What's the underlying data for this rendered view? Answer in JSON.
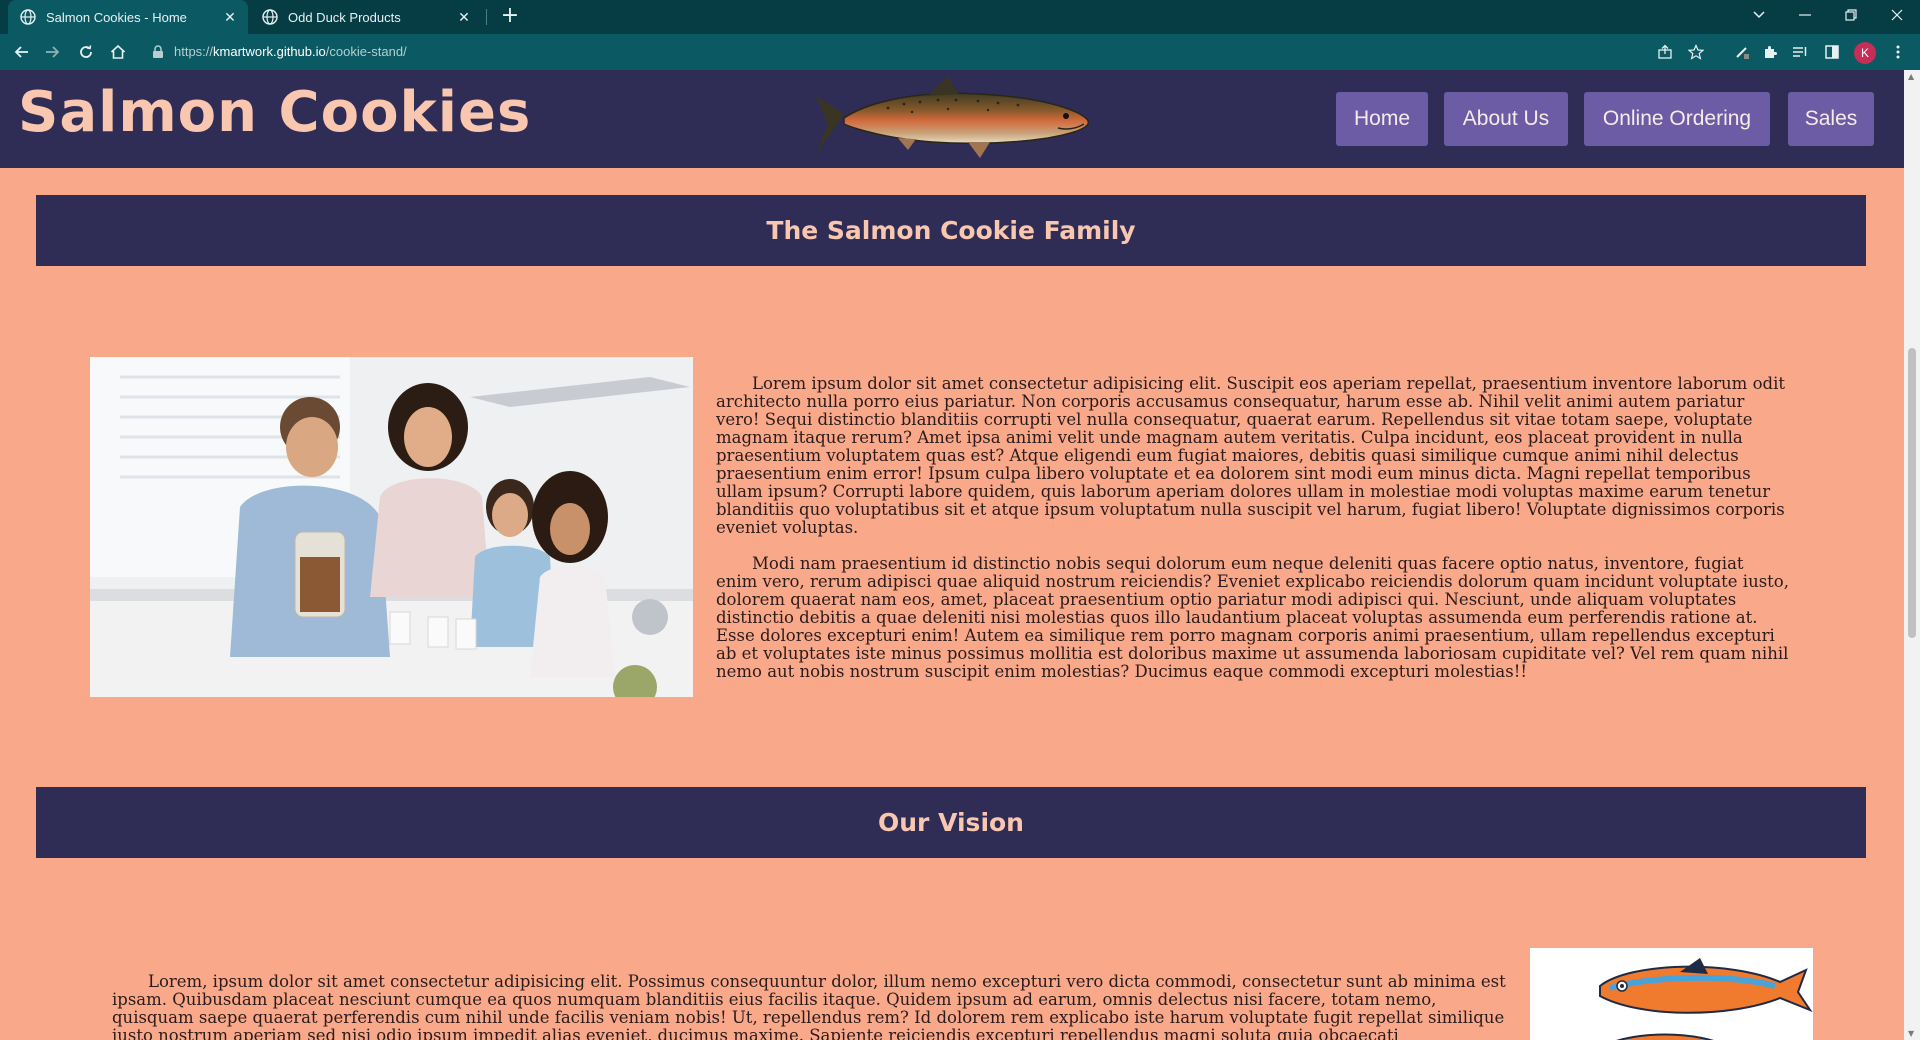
{
  "browser": {
    "tabs": [
      {
        "title": "Salmon Cookies - Home",
        "active": true
      },
      {
        "title": "Odd Duck Products",
        "active": false
      }
    ],
    "url_scheme": "https://",
    "url_host": "kmartwork.github.io",
    "url_path": "/cookie-stand/",
    "profile_initial": "K",
    "colors": {
      "frame": "#063d45",
      "toolbar": "#0b5963",
      "avatar": "#c62d57"
    }
  },
  "site": {
    "title": "Salmon Cookies",
    "nav": [
      "Home",
      "About Us",
      "Online Ordering",
      "Sales"
    ],
    "colors": {
      "header": "#2f2d56",
      "accent": "#f9c7b0",
      "nav_button": "#6b5ca5",
      "background": "#f9a98a"
    }
  },
  "sections": [
    {
      "heading": "The Salmon Cookie Family",
      "paragraphs": [
        "Lorem ipsum dolor sit amet consectetur adipisicing elit. Suscipit eos aperiam repellat, praesentium inventore laborum odit architecto nulla porro eius pariatur. Non corporis accusamus consequatur, harum esse ab. Nihil velit animi autem pariatur vero! Sequi distinctio blanditiis corrupti vel nulla consequatur, quaerat earum. Repellendus sit vitae totam saepe, voluptate magnam itaque rerum? Amet ipsa animi velit unde magnam autem veritatis. Culpa incidunt, eos placeat provident in nulla praesentium voluptatem quas est? Atque eligendi eum fugiat maiores, debitis quasi similique cumque animi nihil delectus praesentium enim error! Ipsum culpa libero voluptate et ea dolorem sint modi eum minus dicta. Magni repellat temporibus ullam ipsum? Corrupti labore quidem, quis laborum aperiam dolores ullam in molestiae modi voluptas maxime earum tenetur blanditiis quo voluptatibus sit et atque ipsum voluptatum nulla suscipit vel harum, fugiat libero! Voluptate dignissimos corporis eveniet voluptas.",
        "Modi nam praesentium id distinctio nobis sequi dolorum eum neque deleniti quas facere optio natus, inventore, fugiat enim vero, rerum adipisci quae aliquid nostrum reiciendis? Eveniet explicabo reiciendis dolorum quam incidunt voluptate iusto, dolorem quaerat nam eos, amet, placeat praesentium optio pariatur modi adipisci qui. Nesciunt, unde aliquam voluptates distinctio debitis a quae deleniti nisi molestias quos illo laudantium placeat voluptas assumenda eum perferendis ratione at. Esse dolores excepturi enim! Autem ea similique rem porro magnam corporis animi praesentium, ullam repellendus excepturi ab et voluptates iste minus possimus mollitia est doloribus maxime ut assumenda laboriosam cupiditate vel? Vel rem quam nihil nemo aut nobis nostrum suscipit enim molestias? Ducimus eaque commodi excepturi molestias!!"
      ]
    },
    {
      "heading": "Our Vision",
      "paragraphs": [
        "Lorem, ipsum dolor sit amet consectetur adipisicing elit. Possimus consequuntur dolor, illum nemo excepturi vero dicta commodi, consectetur sunt ab minima est ipsam. Quibusdam placeat nesciunt cumque ea quos numquam blanditiis eius facilis itaque. Quidem ipsum ad earum, omnis delectus nisi facere, totam nemo, quisquam saepe quaerat perferendis cum nihil unde facilis veniam nobis! Ut, repellendus rem? Id dolorem rem explicabo iste harum voluptate fugit repellat similique iusto nostrum aperiam sed nisi odio ipsum impedit alias eveniet, ducimus maxime. Sapiente reiciendis excepturi repellendus magni soluta quia obcaecati doloremque? Ipsam consequuntur fuga facere"
      ]
    }
  ]
}
